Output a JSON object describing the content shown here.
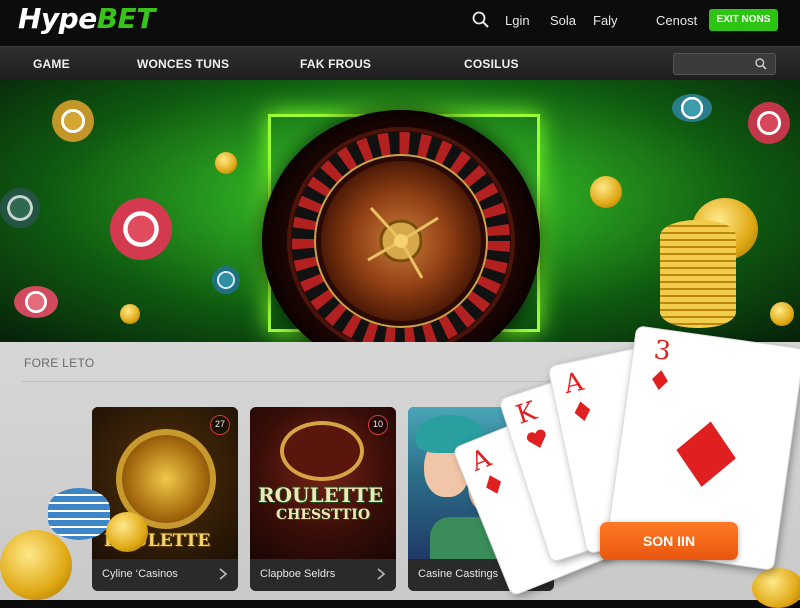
{
  "brand": {
    "name_white": "Hype",
    "name_green": "BET"
  },
  "colors": {
    "accent": "#2ec414",
    "brand_green": "#38c21a",
    "cta_orange": "#ff7a26",
    "dark_bar": "#0c0c0c"
  },
  "header": {
    "search_icon": "search-icon",
    "links": [
      "Lgin",
      "Sola",
      "Faly",
      "Cenost"
    ],
    "cta_label": "EXIT NONS"
  },
  "subnav": {
    "items": [
      "GAME",
      "WONCES TUNS",
      "FAK FROUS",
      "COSILUS"
    ],
    "search_placeholder": "",
    "search_icon": "search-icon"
  },
  "hero": {
    "image": "roulette-wheel-on-green",
    "decor": [
      "poker-chips",
      "gold-coins"
    ]
  },
  "section": {
    "title": "FORE LETO",
    "cards": [
      {
        "art_title": "ROULETTE",
        "label": "Cyline ‘Casinos",
        "badge": "27",
        "chevron": "chevron-right-icon"
      },
      {
        "art_title": "ROULETTE",
        "art_subtitle": "CHESSTTIO",
        "label": "Clapboe Seldrs",
        "badge": "10",
        "chevron": "chevron-right-icon"
      },
      {
        "art_title": "",
        "label": "Casine Castings",
        "badge": "",
        "chevron": "chevron-right-icon"
      }
    ]
  },
  "playing_cards": [
    {
      "rank": "A",
      "suit": "diamond"
    },
    {
      "rank": "K",
      "suit": "heart"
    },
    {
      "rank": "A",
      "suit": "diamond"
    },
    {
      "rank": "3",
      "suit": "diamond"
    }
  ],
  "cta": {
    "label": "SON IIN"
  }
}
